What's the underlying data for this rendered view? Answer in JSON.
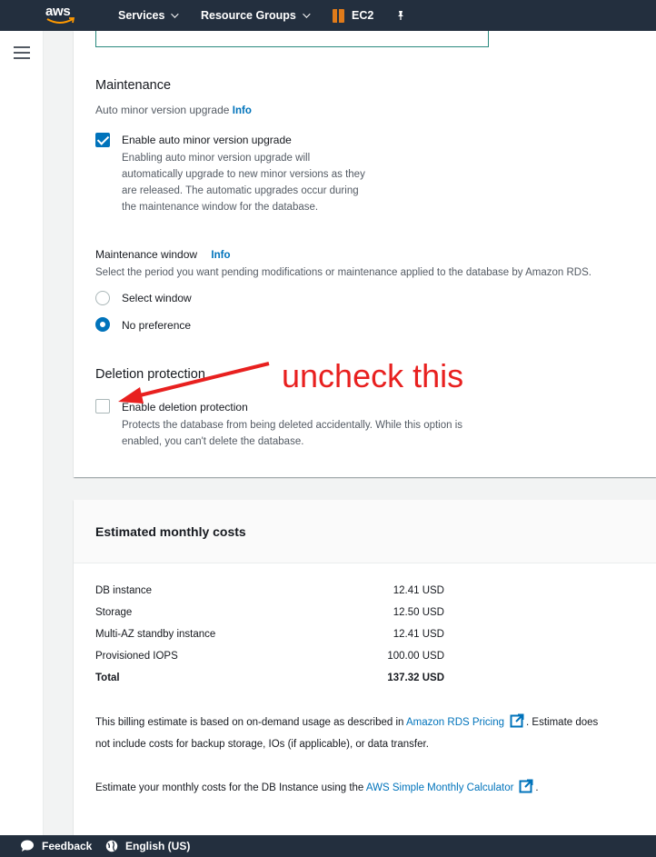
{
  "topnav": {
    "logo_text": "aws",
    "services_label": "Services",
    "resource_groups_label": "Resource Groups",
    "ec2_label": "EC2",
    "pin_icon": "pin-icon"
  },
  "maintenance": {
    "title": "Maintenance",
    "auto_minor_label": "Auto minor version upgrade",
    "info": "Info",
    "enable_auto_label": "Enable auto minor version upgrade",
    "enable_auto_checked": true,
    "enable_auto_hint": [
      "Enabling auto minor version upgrade will",
      "automatically upgrade to new minor versions as they",
      "are released. The automatic upgrades occur during",
      "the maintenance window for the database."
    ],
    "window_label": "Maintenance window",
    "window_info": "Info",
    "window_desc": "Select the period you want pending modifications or maintenance applied to the database by Amazon RDS.",
    "options": [
      {
        "label": "Select window",
        "selected": false
      },
      {
        "label": "No preference",
        "selected": true
      }
    ]
  },
  "deletion": {
    "title": "Deletion protection",
    "enable_label": "Enable deletion protection",
    "enable_checked": false,
    "hint": [
      "Protects the database from being deleted accidentally. While this option is",
      "enabled, you can't delete the database."
    ]
  },
  "annotation": {
    "text": "uncheck this",
    "color": "#e8201f"
  },
  "costs": {
    "title": "Estimated monthly costs",
    "rows": [
      {
        "name": "DB instance",
        "value": "12.41 USD"
      },
      {
        "name": "Storage",
        "value": "12.50 USD"
      },
      {
        "name": "Multi-AZ standby instance",
        "value": "12.41 USD"
      },
      {
        "name": "Provisioned IOPS",
        "value": "100.00 USD"
      },
      {
        "name": "Total",
        "value": "137.32 USD"
      }
    ],
    "billing_pre": "This billing estimate is based on on-demand usage as described in ",
    "billing_link": "Amazon RDS Pricing",
    "billing_post_1": ". Estimate does",
    "billing_post_2": "not include costs for backup storage, IOs (if applicable), or data transfer.",
    "calc_pre": "Estimate your monthly costs for the DB Instance using the ",
    "calc_link": "AWS Simple Monthly Calculator",
    "calc_post": "."
  },
  "footer": {
    "feedback_label": "Feedback",
    "language_label": "English (US)"
  },
  "colors": {
    "nav_bg": "#232f3e",
    "accent_blue": "#0073bb",
    "ec2_orange": "#e07b1a"
  }
}
